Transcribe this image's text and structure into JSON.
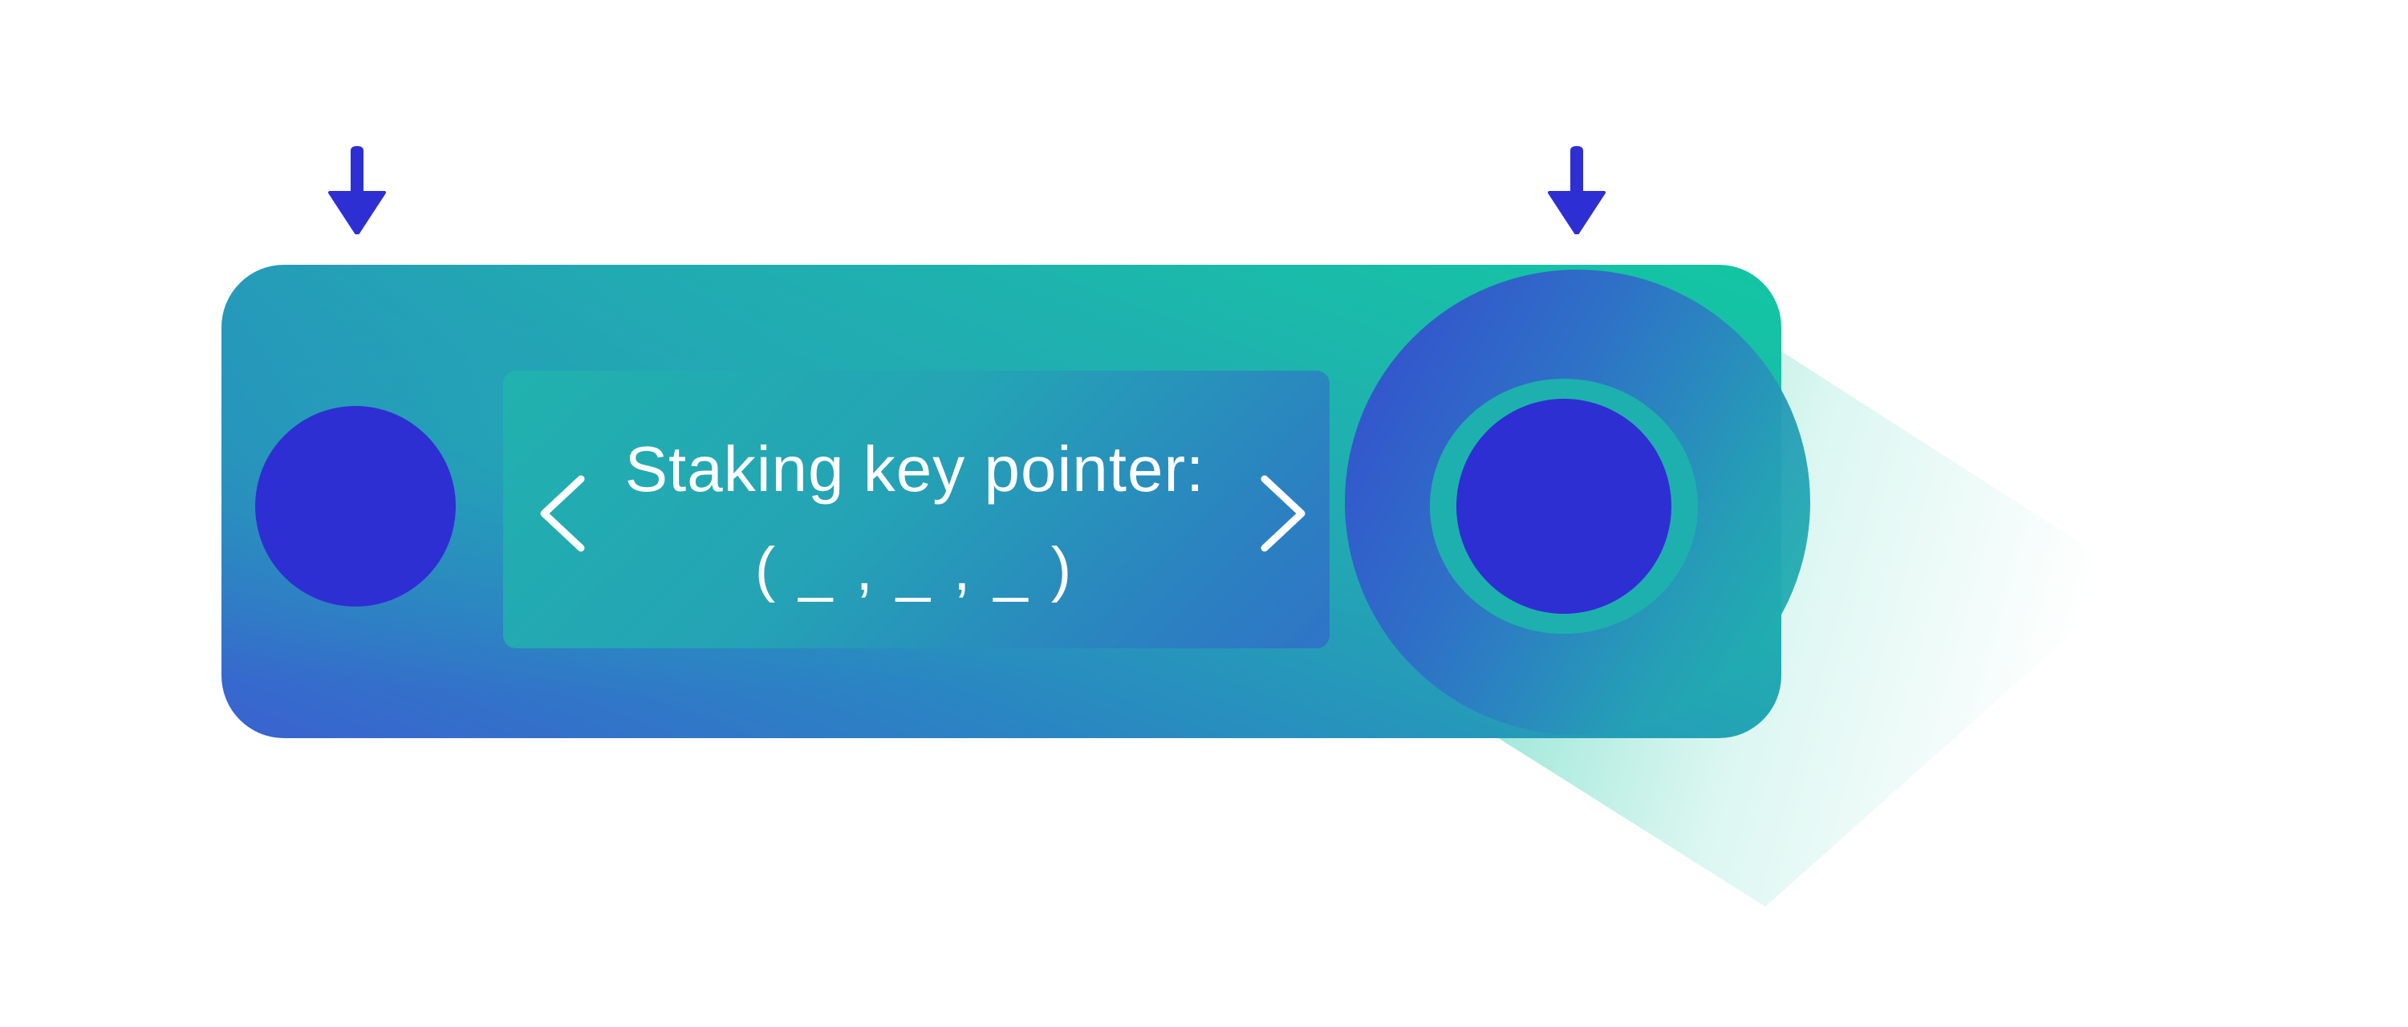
{
  "device": {
    "screen": {
      "title": "Staking key pointer:",
      "value": "( _ , _ , _ )"
    },
    "left_button": {
      "indicator": "arrow-down-icon"
    },
    "right_button": {
      "indicator": "arrow-down-icon"
    },
    "navigation": {
      "previous": "chevron-left-icon",
      "next": "chevron-right-icon"
    }
  },
  "colors": {
    "button": "#2E2FD3",
    "indicator": "#2E2FD3",
    "device_gradient_start": "#3A62CF",
    "device_gradient_end": "#12C6A2",
    "text": "#FFFFFF"
  }
}
